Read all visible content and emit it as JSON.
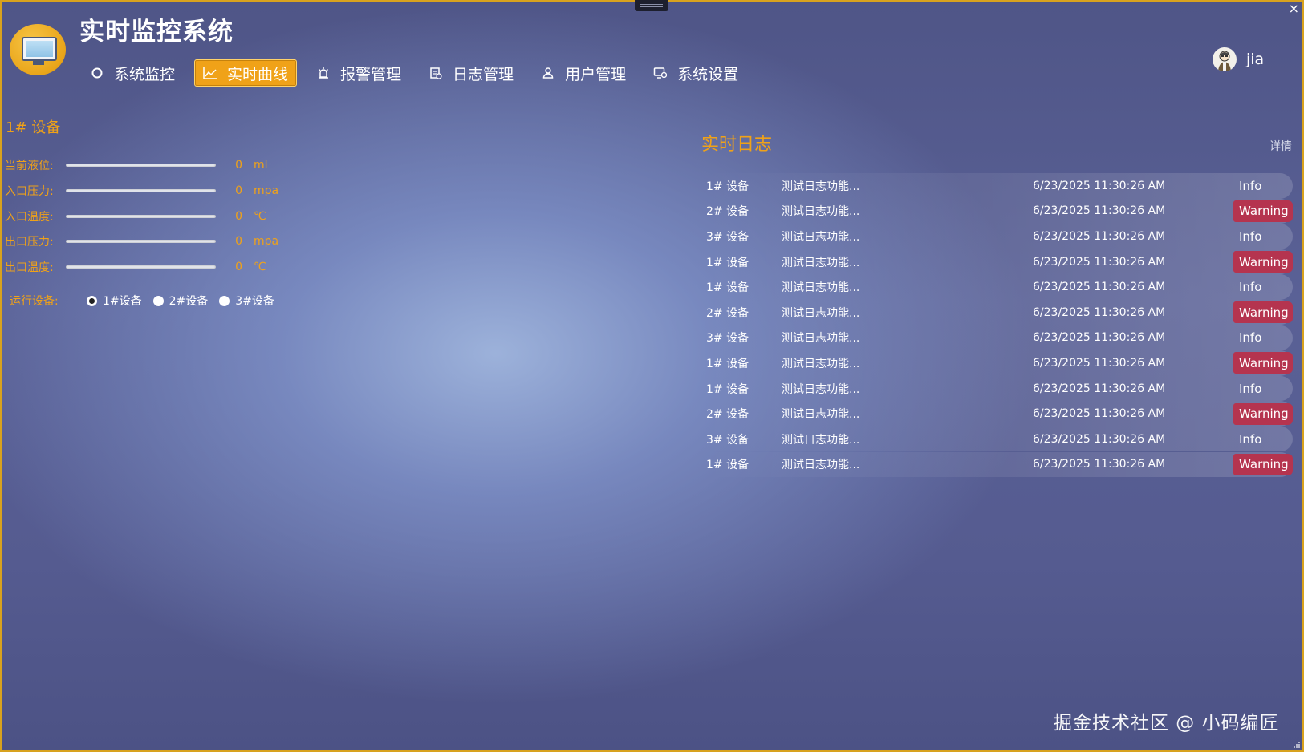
{
  "window": {
    "close_glyph": "×"
  },
  "header": {
    "app_title": "实时监控系统",
    "nav": [
      {
        "label": "系统监控",
        "icon": "circle-icon",
        "active": false
      },
      {
        "label": "实时曲线",
        "icon": "line-chart-icon",
        "active": true
      },
      {
        "label": "报警管理",
        "icon": "alarm-icon",
        "active": false
      },
      {
        "label": "日志管理",
        "icon": "log-icon",
        "active": false
      },
      {
        "label": "用户管理",
        "icon": "user-icon",
        "active": false
      },
      {
        "label": "系统设置",
        "icon": "settings-icon",
        "active": false
      }
    ],
    "user": {
      "name": "jia",
      "avatar_icon": "avatar-icon"
    }
  },
  "device_panel": {
    "title": "1# 设备",
    "metrics": [
      {
        "label": "当前液位:",
        "value": "0",
        "unit": "ml"
      },
      {
        "label": "入口压力:",
        "value": "0",
        "unit": "mpa"
      },
      {
        "label": "入口温度:",
        "value": "0",
        "unit": "℃"
      },
      {
        "label": "出口压力:",
        "value": "0",
        "unit": "mpa"
      },
      {
        "label": "出口温度:",
        "value": "0",
        "unit": "℃"
      }
    ],
    "run_label": "运行设备:",
    "run_options": [
      {
        "label": "1#设备",
        "checked": true
      },
      {
        "label": "2#设备",
        "checked": false
      },
      {
        "label": "3#设备",
        "checked": false
      }
    ]
  },
  "log_panel": {
    "title": "实时日志",
    "detail_link": "详情",
    "rows": [
      {
        "device": "1# 设备",
        "message": "测试日志功能...",
        "time": "6/23/2025 11:30:26 AM",
        "level": "Info"
      },
      {
        "device": "2# 设备",
        "message": "测试日志功能...",
        "time": "6/23/2025 11:30:26 AM",
        "level": "Warning"
      },
      {
        "device": "3# 设备",
        "message": "测试日志功能...",
        "time": "6/23/2025 11:30:26 AM",
        "level": "Info"
      },
      {
        "device": "1# 设备",
        "message": "测试日志功能...",
        "time": "6/23/2025 11:30:26 AM",
        "level": "Warning"
      },
      {
        "device": "1# 设备",
        "message": "测试日志功能...",
        "time": "6/23/2025 11:30:26 AM",
        "level": "Info"
      },
      {
        "device": "2# 设备",
        "message": "测试日志功能...",
        "time": "6/23/2025 11:30:26 AM",
        "level": "Warning"
      },
      {
        "device": "3# 设备",
        "message": "测试日志功能...",
        "time": "6/23/2025 11:30:26 AM",
        "level": "Info"
      },
      {
        "device": "1# 设备",
        "message": "测试日志功能...",
        "time": "6/23/2025 11:30:26 AM",
        "level": "Warning"
      },
      {
        "device": "1# 设备",
        "message": "测试日志功能...",
        "time": "6/23/2025 11:30:26 AM",
        "level": "Info"
      },
      {
        "device": "2# 设备",
        "message": "测试日志功能...",
        "time": "6/23/2025 11:30:26 AM",
        "level": "Warning"
      },
      {
        "device": "3# 设备",
        "message": "测试日志功能...",
        "time": "6/23/2025 11:30:26 AM",
        "level": "Info"
      },
      {
        "device": "1# 设备",
        "message": "测试日志功能...",
        "time": "6/23/2025 11:30:26 AM",
        "level": "Warning"
      }
    ]
  },
  "watermark": "掘金技术社区 @ 小码编匠",
  "colors": {
    "accent": "#f0a218",
    "border": "#d8a21e",
    "warning_bg": "#b5344f",
    "text": "#ffffff"
  }
}
